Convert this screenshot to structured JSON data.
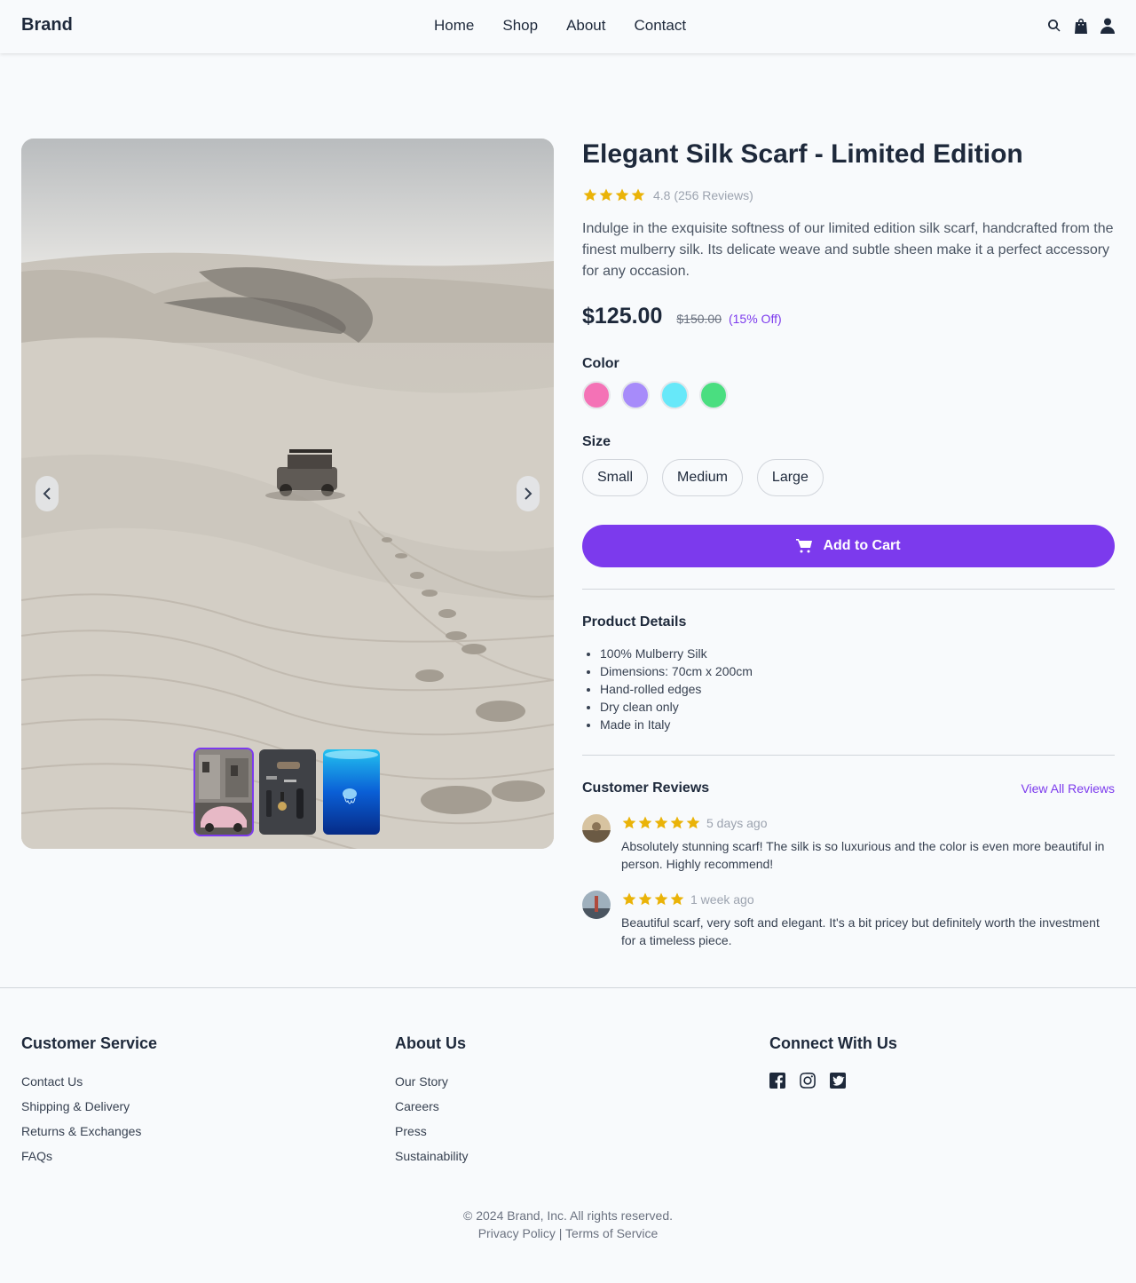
{
  "header": {
    "brand": "Brand",
    "nav": [
      "Home",
      "Shop",
      "About",
      "Contact"
    ],
    "icons": [
      "search-icon",
      "shopping-bag-icon",
      "user-icon"
    ]
  },
  "product": {
    "title": "Elegant Silk Scarf - Limited Edition",
    "rating": 4.8,
    "rating_text": "4.8 (256 Reviews)",
    "description": "Indulge in the exquisite softness of our limited edition silk scarf, handcrafted from the finest mulberry silk. Its delicate weave and subtle sheen make it a perfect accessory for any occasion.",
    "price": "$125.00",
    "old_price": "$150.00",
    "discount": "(15% Off)",
    "color_label": "Color",
    "colors": [
      "#f472b6",
      "#a78bfa",
      "#67e8f9",
      "#4ade80"
    ],
    "size_label": "Size",
    "sizes": [
      "Small",
      "Medium",
      "Large"
    ],
    "cart_label": "Add to Cart",
    "accent": "#7c3aed"
  },
  "details": {
    "title": "Product Details",
    "items": [
      "100% Mulberry Silk",
      "Dimensions: 70cm x 200cm",
      "Hand-rolled edges",
      "Dry clean only",
      "Made in Italy"
    ]
  },
  "reviews": {
    "title": "Customer Reviews",
    "view_all": "View All Reviews",
    "items": [
      {
        "stars": 5,
        "date": "5 days ago",
        "text": "Absolutely stunning scarf! The silk is so luxurious and the color is even more beautiful in person. Highly recommend!"
      },
      {
        "stars": 4,
        "date": "1 week ago",
        "text": "Beautiful scarf, very soft and elegant. It's a bit pricey but definitely worth the investment for a timeless piece."
      }
    ]
  },
  "footer": {
    "customer_service": {
      "title": "Customer Service",
      "links": [
        "Contact Us",
        "Shipping & Delivery",
        "Returns & Exchanges",
        "FAQs"
      ]
    },
    "about": {
      "title": "About Us",
      "links": [
        "Our Story",
        "Careers",
        "Press",
        "Sustainability"
      ]
    },
    "connect": {
      "title": "Connect With Us",
      "icons": [
        "facebook-icon",
        "instagram-icon",
        "twitter-icon"
      ]
    },
    "copyright": "© 2024 Brand, Inc. All rights reserved.",
    "privacy": "Privacy Policy",
    "separator": "|",
    "terms": "Terms of Service"
  }
}
